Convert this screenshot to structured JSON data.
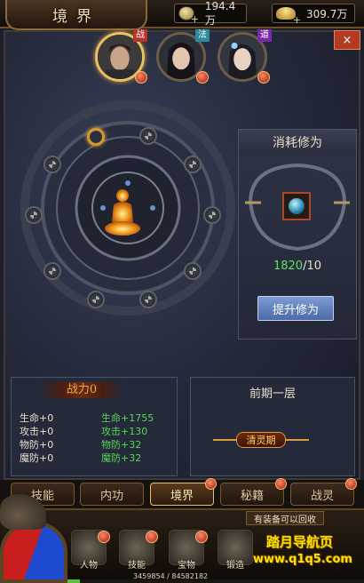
{
  "header": {
    "title": "境界"
  },
  "currency": {
    "coins": "194.4万",
    "ingots": "309.7万"
  },
  "close_label": "×",
  "characters": [
    {
      "tag": "战",
      "tag_color": "#b8342a"
    },
    {
      "tag": "法",
      "tag_color": "#2a8aa0"
    },
    {
      "tag": "道",
      "tag_color": "#7a2aa8"
    }
  ],
  "consume": {
    "title": "消耗修为",
    "have": "1820",
    "need": "/10",
    "button_label": "提升修为"
  },
  "stats": {
    "power_label": "战力0",
    "base": [
      "生命+0",
      "攻击+0",
      "物防+0",
      "魔防+0"
    ],
    "next": [
      "生命+1755",
      "攻击+130",
      "物防+32",
      "魔防+32"
    ]
  },
  "stage": {
    "title": "前期一层",
    "badge": "清灵期"
  },
  "tabs": [
    "技能",
    "内功",
    "境界",
    "秘籍",
    "战灵"
  ],
  "active_tab": "境界",
  "nav": [
    "人物",
    "技能",
    "宝物",
    "锻造"
  ],
  "recycle_label": "有装备可以回收",
  "exp": {
    "text": "3459854 / 84582182",
    "fraction": 0.041
  },
  "watermark": {
    "line1": "踏月导航页",
    "line2": "www.q1q5.com"
  },
  "colors": {
    "accent_gold": "#e9c261",
    "green": "#55d855",
    "button_blue": "#6a89c6"
  }
}
